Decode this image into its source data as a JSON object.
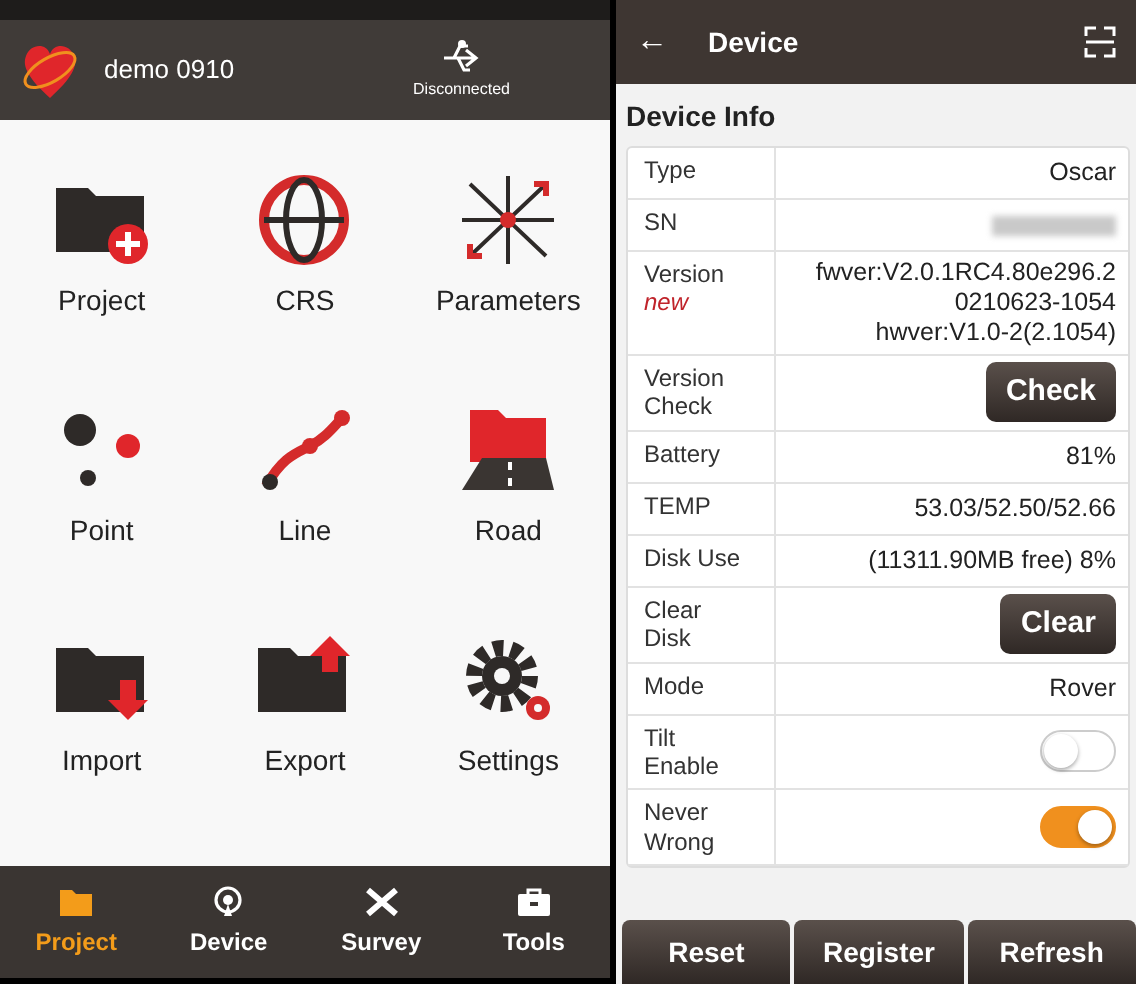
{
  "project_screen": {
    "header": {
      "title": "demo 0910",
      "connection": "Disconnected"
    },
    "tiles": [
      {
        "label": "Project"
      },
      {
        "label": "CRS"
      },
      {
        "label": "Parameters"
      },
      {
        "label": "Point"
      },
      {
        "label": "Line"
      },
      {
        "label": "Road"
      },
      {
        "label": "Import"
      },
      {
        "label": "Export"
      },
      {
        "label": "Settings"
      }
    ],
    "nav": [
      {
        "label": "Project",
        "selected": true
      },
      {
        "label": "Device",
        "selected": false
      },
      {
        "label": "Survey",
        "selected": false
      },
      {
        "label": "Tools",
        "selected": false
      }
    ]
  },
  "device_screen": {
    "header": {
      "back": "←",
      "title": "Device"
    },
    "section": "Device Info",
    "rows": [
      {
        "kind": "text",
        "label": "Type",
        "value": "Oscar"
      },
      {
        "kind": "hidden",
        "label": "SN"
      },
      {
        "kind": "lines",
        "label": "Version",
        "badge": "new",
        "lines": [
          "fwver:V2.0.1RC4.80e296.2",
          "0210623-1054",
          "hwver:V1.0-2(2.1054)"
        ]
      },
      {
        "kind": "button",
        "label": "Version Check",
        "button": "Check"
      },
      {
        "kind": "text",
        "label": "Battery",
        "value": "81%"
      },
      {
        "kind": "text",
        "label": "TEMP",
        "value": "53.03/52.50/52.66"
      },
      {
        "kind": "text",
        "label": "Disk Use",
        "value": "(11311.90MB free) 8%"
      },
      {
        "kind": "button",
        "label": "Clear Disk",
        "button": "Clear"
      },
      {
        "kind": "text",
        "label": "Mode",
        "value": "Rover"
      },
      {
        "kind": "switch",
        "label": "Tilt Enable",
        "on": false
      },
      {
        "kind": "switch",
        "label": "Never Wrong",
        "on": true
      }
    ],
    "buttons": [
      "Reset",
      "Register",
      "Refresh"
    ]
  }
}
